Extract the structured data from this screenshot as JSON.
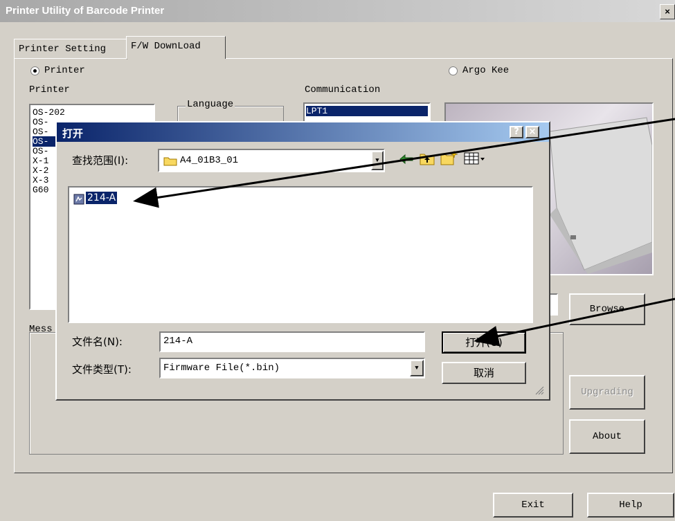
{
  "window": {
    "title": "Printer Utility of Barcode Printer",
    "close_glyph": "×"
  },
  "tabs": [
    {
      "label": "Printer Setting"
    },
    {
      "label": "F/W DownLoad"
    }
  ],
  "radios": {
    "printer": "Printer",
    "argo": "Argo Kee"
  },
  "printer_section": {
    "label": "Printer",
    "items": [
      "OS-202",
      "OS-",
      "OS-",
      "OS-",
      "OS-",
      "X-1",
      "X-2",
      "X-3",
      "G60"
    ],
    "selected_index": 3
  },
  "language_label": "Language",
  "communication": {
    "label": "Communication",
    "items": [
      "LPT1"
    ]
  },
  "message_label": "Mess",
  "buttons": {
    "browse": "Browse",
    "upgrading": "Upgrading",
    "about": "About",
    "exit": "Exit",
    "help": "Help"
  },
  "dialog": {
    "title": "打开",
    "help_glyph": "?",
    "close_glyph": "×",
    "lookin_label": "查找范围(I):",
    "lookin_value": "A4_01B3_01",
    "files": [
      {
        "name": "214-A"
      }
    ],
    "filename_label": "文件名(N):",
    "filename_value": "214-A",
    "filetype_label": "文件类型(T):",
    "filetype_value": "Firmware File(*.bin)",
    "open_button": "打开(O)",
    "cancel_button": "取消"
  },
  "icons": {
    "back": "back-arrow-icon",
    "up": "up-folder-icon",
    "newfolder": "new-folder-icon",
    "view": "view-menu-icon",
    "folder": "folder-icon",
    "file": "firmware-file-icon"
  },
  "colors": {
    "selection": "#0a246a",
    "dialog_title": "#0a246a",
    "face": "#d4d0c8",
    "arrow": "#000000"
  }
}
